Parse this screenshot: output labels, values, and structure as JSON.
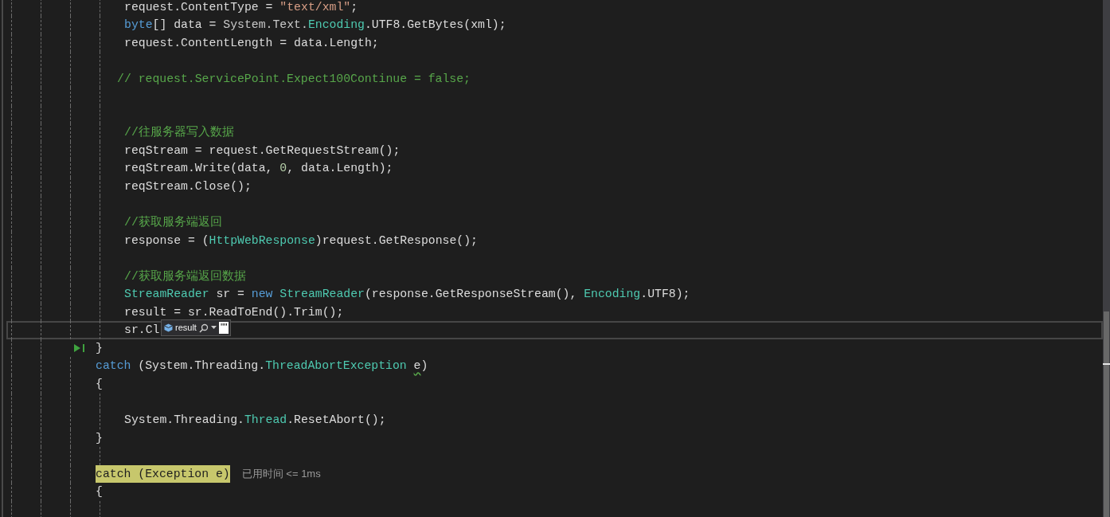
{
  "editor": {
    "lines": [
      {
        "kind": "block",
        "current": false,
        "highlighted": false,
        "run_to_click": false,
        "tokens": [
          {
            "text": "request.ContentType = ",
            "kind": "plain"
          },
          {
            "text": "\"text/xml\"",
            "kind": "string"
          },
          {
            "text": ";",
            "kind": "plain"
          }
        ]
      },
      {
        "kind": "block",
        "current": false,
        "highlighted": false,
        "run_to_click": false,
        "tokens": [
          {
            "text": "byte",
            "kind": "keyword"
          },
          {
            "text": "[] data = ",
            "kind": "plain"
          },
          {
            "text": "System.Text.",
            "kind": "namespace"
          },
          {
            "text": "Encoding",
            "kind": "type"
          },
          {
            "text": ".UTF8.GetBytes(xml);",
            "kind": "plain"
          }
        ]
      },
      {
        "kind": "block",
        "current": false,
        "highlighted": false,
        "run_to_click": false,
        "tokens": [
          {
            "text": "request.ContentLength = data.Length;",
            "kind": "plain"
          }
        ]
      },
      {
        "kind": "blank",
        "current": false,
        "highlighted": false,
        "run_to_click": false
      },
      {
        "kind": "outdented",
        "current": false,
        "highlighted": false,
        "run_to_click": false,
        "tokens": [
          {
            "text": "// request.ServicePoint.Expect100Continue = false;",
            "kind": "comment"
          }
        ]
      },
      {
        "kind": "blank",
        "current": false,
        "highlighted": false,
        "run_to_click": false
      },
      {
        "kind": "blank",
        "current": false,
        "highlighted": false,
        "run_to_click": false
      },
      {
        "kind": "block",
        "current": false,
        "highlighted": false,
        "run_to_click": false,
        "tokens": [
          {
            "text": "//往服务器写入数据",
            "kind": "comment"
          }
        ]
      },
      {
        "kind": "block",
        "current": false,
        "highlighted": false,
        "run_to_click": false,
        "tokens": [
          {
            "text": "reqStream = request.GetRequestStream();",
            "kind": "plain"
          }
        ]
      },
      {
        "kind": "block",
        "current": false,
        "highlighted": false,
        "run_to_click": false,
        "tokens": [
          {
            "text": "reqStream.Write(data, ",
            "kind": "plain"
          },
          {
            "text": "0",
            "kind": "number"
          },
          {
            "text": ", data.Length);",
            "kind": "plain"
          }
        ]
      },
      {
        "kind": "block",
        "current": false,
        "highlighted": false,
        "run_to_click": false,
        "tokens": [
          {
            "text": "reqStream.Close();",
            "kind": "plain"
          }
        ]
      },
      {
        "kind": "blank",
        "current": false,
        "highlighted": false,
        "run_to_click": false
      },
      {
        "kind": "block",
        "current": false,
        "highlighted": false,
        "run_to_click": false,
        "tokens": [
          {
            "text": "//获取服务端返回",
            "kind": "comment"
          }
        ]
      },
      {
        "kind": "block",
        "current": false,
        "highlighted": false,
        "run_to_click": false,
        "tokens": [
          {
            "text": "response = (",
            "kind": "plain"
          },
          {
            "text": "HttpWebResponse",
            "kind": "type"
          },
          {
            "text": ")request.GetResponse();",
            "kind": "plain"
          }
        ]
      },
      {
        "kind": "blank",
        "current": false,
        "highlighted": false,
        "run_to_click": false
      },
      {
        "kind": "block",
        "current": false,
        "highlighted": false,
        "run_to_click": false,
        "tokens": [
          {
            "text": "//获取服务端返回数据",
            "kind": "comment"
          }
        ]
      },
      {
        "kind": "block",
        "current": false,
        "highlighted": false,
        "run_to_click": false,
        "tokens": [
          {
            "text": "StreamReader",
            "kind": "type"
          },
          {
            "text": " sr = ",
            "kind": "plain"
          },
          {
            "text": "new",
            "kind": "keyword"
          },
          {
            "text": " StreamReader",
            "kind": "type"
          },
          {
            "text": "(response.GetResponseStream(), ",
            "kind": "plain"
          },
          {
            "text": "Encoding",
            "kind": "type"
          },
          {
            "text": ".UTF8);",
            "kind": "plain"
          }
        ]
      },
      {
        "kind": "block",
        "current": false,
        "highlighted": false,
        "run_to_click": false,
        "tokens": [
          {
            "text": "result = sr.ReadToEnd().Trim();",
            "kind": "plain"
          }
        ]
      },
      {
        "kind": "block",
        "current": true,
        "highlighted": false,
        "run_to_click": false,
        "tokens": [
          {
            "text": "sr.Cl",
            "kind": "plain"
          }
        ],
        "datatip": {
          "name": "result",
          "value": "\"\""
        }
      },
      {
        "kind": "brace",
        "current": false,
        "highlighted": false,
        "run_to_click": true,
        "tokens": [
          {
            "text": "}",
            "kind": "plain"
          }
        ]
      },
      {
        "kind": "brace",
        "current": false,
        "highlighted": false,
        "run_to_click": false,
        "tokens": [
          {
            "text": "catch",
            "kind": "keyword"
          },
          {
            "text": " (System.Threading.",
            "kind": "plain"
          },
          {
            "text": "ThreadAbortException ",
            "kind": "type"
          },
          {
            "text": "e",
            "kind": "warning"
          },
          {
            "text": ")",
            "kind": "plain"
          }
        ]
      },
      {
        "kind": "brace",
        "current": false,
        "highlighted": false,
        "run_to_click": false,
        "tokens": [
          {
            "text": "{",
            "kind": "plain"
          }
        ]
      },
      {
        "kind": "blank",
        "current": false,
        "highlighted": false,
        "run_to_click": false
      },
      {
        "kind": "block",
        "current": false,
        "highlighted": false,
        "run_to_click": false,
        "tokens": [
          {
            "text": "System.Threading.",
            "kind": "plain"
          },
          {
            "text": "Thread",
            "kind": "type"
          },
          {
            "text": ".ResetAbort();",
            "kind": "plain"
          }
        ]
      },
      {
        "kind": "brace",
        "current": false,
        "highlighted": false,
        "run_to_click": false,
        "tokens": [
          {
            "text": "}",
            "kind": "plain"
          }
        ]
      },
      {
        "kind": "blank",
        "current": false,
        "highlighted": false,
        "run_to_click": false
      },
      {
        "kind": "brace",
        "current": false,
        "highlighted": true,
        "run_to_click": false,
        "tokens": [
          {
            "text": "catch (Exception e)",
            "kind": "plain"
          }
        ],
        "perf_tip": "已用时间 <= 1ms"
      },
      {
        "kind": "brace",
        "current": false,
        "highlighted": false,
        "run_to_click": false,
        "tokens": [
          {
            "text": "{",
            "kind": "plain"
          }
        ]
      },
      {
        "kind": "blank",
        "current": false,
        "highlighted": false,
        "run_to_click": false
      }
    ]
  }
}
